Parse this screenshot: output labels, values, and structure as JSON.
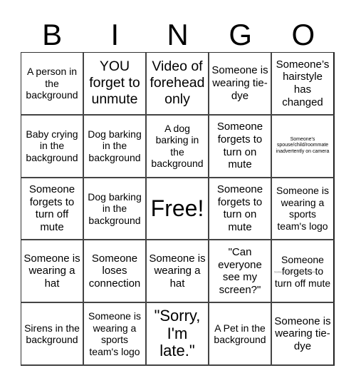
{
  "card": {
    "header": [
      "B",
      "I",
      "N",
      "G",
      "O"
    ],
    "cells": [
      {
        "text": "A person in the background",
        "size": "fs-sm"
      },
      {
        "text": "YOU forget to unmute",
        "size": "fs-xl"
      },
      {
        "text": "Video of forehead only",
        "size": "fs-xl"
      },
      {
        "text": "Someone is wearing tie-dye",
        "size": "fs-md"
      },
      {
        "text": "Someone’s hairstyle has changed",
        "size": "fs-md"
      },
      {
        "text": "Baby crying in the background",
        "size": "fs-sm"
      },
      {
        "text": "Dog barking in the background",
        "size": "fs-sm"
      },
      {
        "text": "A dog barking in the background",
        "size": "fs-sm"
      },
      {
        "text": "Someone forgets to turn on mute",
        "size": "fs-md"
      },
      {
        "text": "Someone's spouse/child/roommate inadvertently on camera",
        "size": "fs-tiny"
      },
      {
        "text": "Someone forgets to turn off mute",
        "size": "fs-md"
      },
      {
        "text": "Dog barking in the background",
        "size": "fs-sm"
      },
      {
        "text": "Free!",
        "size": "fs-free"
      },
      {
        "text": "Someone forgets to turn on mute",
        "size": "fs-md"
      },
      {
        "text": "Someone is wearing a sports team's logo",
        "size": "fs-sm"
      },
      {
        "text": "Someone is wearing a hat",
        "size": "fs-md"
      },
      {
        "text": "Someone loses connection",
        "size": "fs-md"
      },
      {
        "text": "Someone is wearing a hat",
        "size": "fs-md"
      },
      {
        "text": "\"Can everyone see my screen?\"",
        "size": "fs-md"
      },
      {
        "text": "Someone forgets to turn off mute",
        "size": "fs-sm",
        "overlay": "Someone forgets to turn off mute"
      },
      {
        "text": "Sirens in the background",
        "size": "fs-sm"
      },
      {
        "text": "Someone is wearing a sports team's logo",
        "size": "fs-sm"
      },
      {
        "text": "\"Sorry, I'm late.\"",
        "size": "fs-xxl"
      },
      {
        "text": "A Pet in the background",
        "size": "fs-sm"
      },
      {
        "text": "Someone is wearing tie-dye",
        "size": "fs-md"
      }
    ]
  }
}
